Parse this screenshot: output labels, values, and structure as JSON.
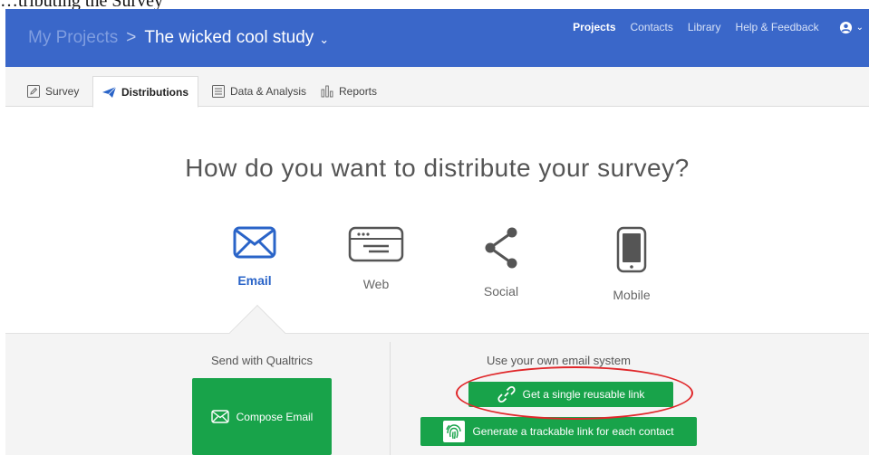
{
  "caption": "…tributing the Survey",
  "header": {
    "breadcrumb_root": "My Projects",
    "breadcrumb_separator": ">",
    "project_name": "The wicked cool study",
    "nav": [
      "Projects",
      "Contacts",
      "Library",
      "Help & Feedback"
    ],
    "active_nav": "Projects",
    "user_icon": "user-circle-icon",
    "bar_color": "#3a67c9"
  },
  "tabs": [
    {
      "label": "Survey",
      "icon": "pencil-icon"
    },
    {
      "label": "Distributions",
      "icon": "paper-plane-icon",
      "active": true
    },
    {
      "label": "Data & Analysis",
      "icon": "data-list-icon"
    },
    {
      "label": "Reports",
      "icon": "bar-chart-icon"
    }
  ],
  "main": {
    "heading": "How do you want to distribute your survey?",
    "methods": [
      {
        "label": "Email",
        "icon": "envelope-icon",
        "active": true
      },
      {
        "label": "Web",
        "icon": "browser-window-icon"
      },
      {
        "label": "Social",
        "icon": "share-icon"
      },
      {
        "label": "Mobile",
        "icon": "mobile-phone-icon"
      }
    ],
    "accent_color": "#2a64c8"
  },
  "email_options": {
    "left_title": "Send with Qualtrics",
    "compose_button": "Compose Email",
    "right_title": "Use your own email system",
    "single_link_button": "Get a single reusable link",
    "trackable_button": "Generate a trackable link for each contact",
    "button_color": "#18a34a",
    "highlight_color": "#e0272a"
  }
}
